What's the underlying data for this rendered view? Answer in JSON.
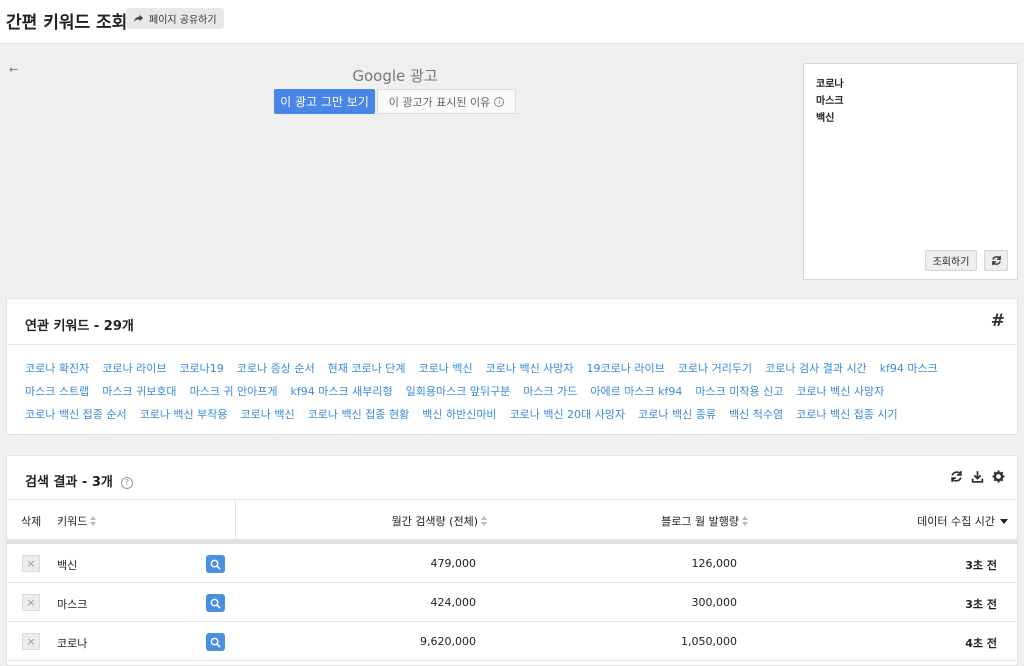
{
  "header": {
    "title": "간편 키워드 조회",
    "share_label": "페이지 공유하기"
  },
  "ad": {
    "back_arrow": "←",
    "google_label": "Google 광고",
    "stop_label": "이 광고 그만 보기",
    "why_label": "이 광고가 표시된 이유"
  },
  "query": {
    "lines": [
      "코로나",
      "마스크",
      "백신"
    ],
    "search_label": "조회하기"
  },
  "related": {
    "title": "연관 키워드 - 29개",
    "rows": [
      [
        "코로나 확진자",
        "코로나 라이브",
        "코로나19",
        "코로나 증상 순서",
        "현재 코로나 단계",
        "코로나 백신",
        "코로나 백신 사망자",
        "19코로나 라이브",
        "코로나 거리두기",
        "코로나 검사 결과 시간",
        "kf94 마스크"
      ],
      [
        "마스크 스트랩",
        "마스크 귀보호대",
        "마스크 귀 안아프게",
        "kf94 마스크 새부리형",
        "일회용마스크 앞뒤구분",
        "마스크 가드",
        "아에르 마스크 kf94",
        "마스크 미착용 신고",
        "코로나 백신 사망자"
      ],
      [
        "코로나 백신 접종 순서",
        "코로나 백신 부작용",
        "코로나 백신",
        "코로나 백신 접종 현황",
        "백신 하반신마비",
        "코로나 백신 20대 사망자",
        "코로나 백신 종류",
        "백신 척수염",
        "코로나 백신 접종 시기"
      ]
    ]
  },
  "results": {
    "title": "검색 결과 - 3개",
    "help": "?",
    "columns": {
      "delete": "삭제",
      "keyword": "키워드",
      "monthly": "월간 검색량 (전체)",
      "blog": "블로그 월 발행량",
      "time": "데이터 수집 시간"
    },
    "rows": [
      {
        "keyword": "백신",
        "monthly": "479,000",
        "blog": "126,000",
        "time": "3초 전"
      },
      {
        "keyword": "마스크",
        "monthly": "424,000",
        "blog": "300,000",
        "time": "3초 전"
      },
      {
        "keyword": "코로나",
        "monthly": "9,620,000",
        "blog": "1,050,000",
        "time": "4초 전"
      }
    ]
  },
  "colors": {
    "accent": "#4a86e8",
    "link": "#3b8ad9"
  }
}
